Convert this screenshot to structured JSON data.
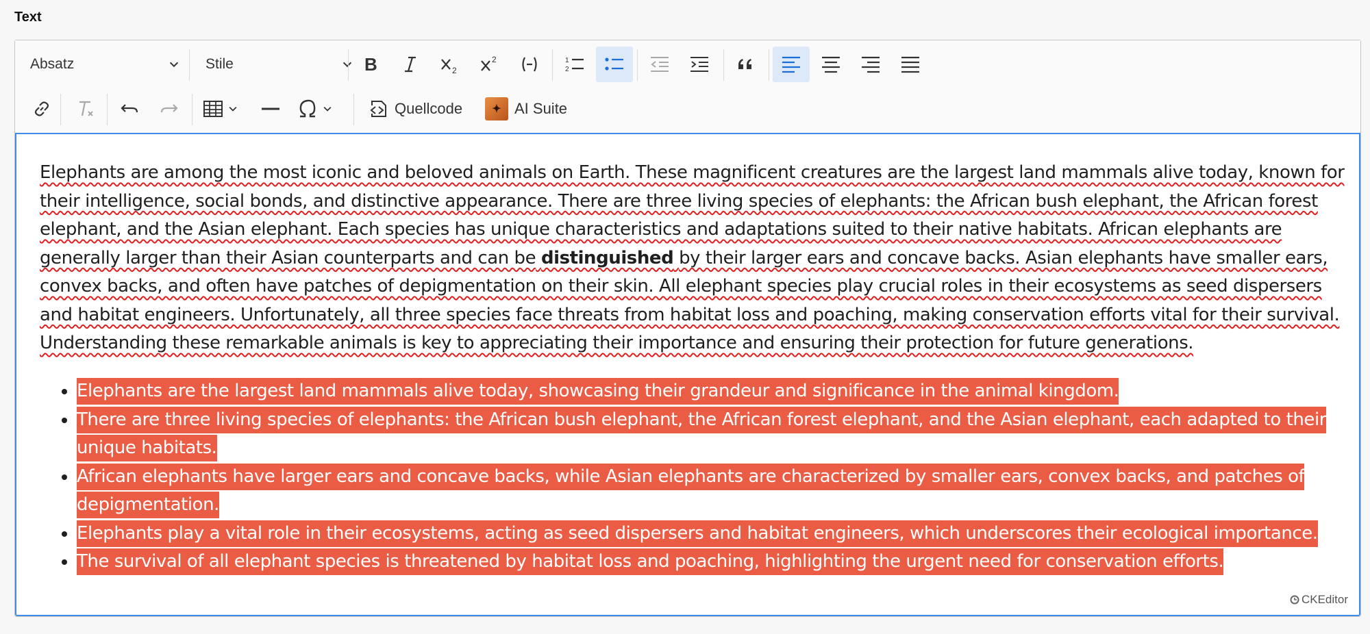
{
  "field_label": "Text",
  "toolbar": {
    "paragraph_dropdown": "Absatz",
    "style_dropdown": "Stile",
    "source_label": "Quellcode",
    "ai_label": "AI Suite"
  },
  "icons": {
    "bold": "bold-icon",
    "italic": "italic-icon",
    "subscript": "subscript-icon",
    "superscript": "superscript-icon",
    "code": "code-icon",
    "numbered_list": "numbered-list-icon",
    "bulleted_list": "bulleted-list-icon",
    "outdent": "outdent-icon",
    "indent": "indent-icon",
    "blockquote": "blockquote-icon",
    "align_left": "align-left-icon",
    "align_center": "align-center-icon",
    "align_right": "align-right-icon",
    "justify": "justify-icon",
    "link": "link-icon",
    "remove_format": "remove-format-icon",
    "undo": "undo-icon",
    "redo": "redo-icon",
    "table": "table-icon",
    "horizontal_line": "horizontal-line-icon",
    "special_chars": "omega-icon"
  },
  "active_buttons": [
    "bulleted_list",
    "align_left"
  ],
  "content": {
    "para_1": "Elephants are among the most iconic and beloved animals on Earth. These magnificent creatures are the largest land mammals alive today, known for their intelligence, social bonds, and distinctive appearance. There are three living species of elephants: the African bush elephant, the African forest elephant, and the Asian elephant. Each species has unique characteristics and adaptations suited to their native habitats. African elephants are generally larger than their Asian counterparts and can be",
    "bold_word": "distinguished",
    "para_2": "by their larger ears and concave backs. Asian elephants have smaller ears, convex backs, and often have patches of depigmentation on their skin. All elephant species play crucial roles in their ecosystems as seed dispersers and habitat engineers. Unfortunately, all three species face threats from habitat loss and poaching, making conservation efforts vital for their survival. Understanding these remarkable animals is key to appreciating their importance and ensuring their protection for future generations.",
    "bullets": [
      "Elephants are the largest land mammals alive today, showcasing their grandeur and significance in the animal kingdom.",
      "There are three living species of elephants: the African bush elephant, the African forest elephant, and the Asian elephant, each adapted to their unique habitats.",
      "African elephants have larger ears and concave backs, while Asian elephants are characterized by smaller ears, convex backs, and patches of depigmentation.",
      "Elephants play a vital role in their ecosystems, acting as seed dispersers and habitat engineers, which underscores their ecological importance.",
      "The survival of all elephant species is threatened by habitat loss and poaching, highlighting the urgent need for conservation efforts."
    ]
  },
  "branding": "CKEditor",
  "colors": {
    "highlight": "#eb5c45",
    "focus_border": "#3d8ce8",
    "active_button": "#dde9f8"
  }
}
